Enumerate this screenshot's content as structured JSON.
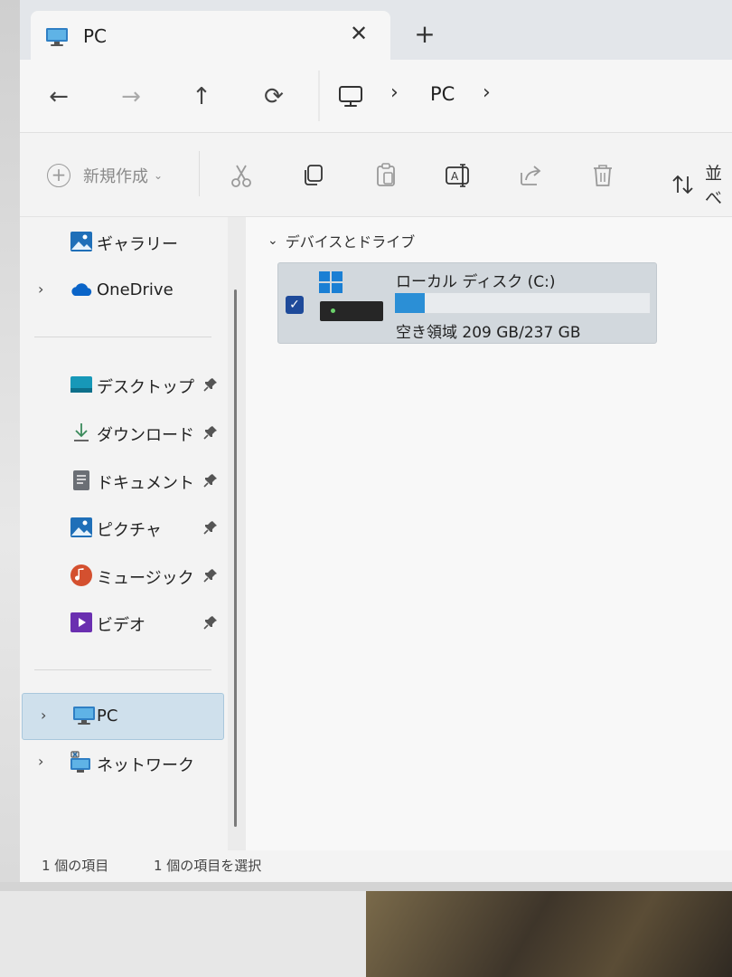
{
  "window": {
    "tab_title": "PC",
    "tab_close": "✕",
    "new_tab": "+"
  },
  "navigation": {
    "back": "←",
    "forward": "→",
    "up": "↑",
    "refresh": "⟳",
    "breadcrumb": [
      "PC"
    ],
    "chevron": "›"
  },
  "toolbar": {
    "new_label": "新規作成",
    "sort_label": "並べ"
  },
  "sidebar": {
    "top_items": [
      {
        "label": "ギャラリー",
        "icon": "gallery-icon"
      },
      {
        "label": "OneDrive",
        "icon": "onedrive-icon"
      }
    ],
    "quick_access": [
      {
        "label": "デスクトップ",
        "icon": "desktop-icon"
      },
      {
        "label": "ダウンロード",
        "icon": "download-icon"
      },
      {
        "label": "ドキュメント",
        "icon": "documents-icon"
      },
      {
        "label": "ピクチャ",
        "icon": "pictures-icon"
      },
      {
        "label": "ミュージック",
        "icon": "music-icon"
      },
      {
        "label": "ビデオ",
        "icon": "videos-icon"
      }
    ],
    "bottom_items": [
      {
        "label": "PC",
        "icon": "pc-icon",
        "selected": true
      },
      {
        "label": "ネットワーク",
        "icon": "network-icon"
      }
    ]
  },
  "main": {
    "group_header": "デバイスとドライブ",
    "drive": {
      "name": "ローカル ディスク (C:)",
      "space_text": "空き領域 209 GB/237 GB",
      "used_fraction": 0.118,
      "checked": true
    }
  },
  "status": {
    "item_count": "1 個の項目",
    "selected_count": "1 個の項目を選択"
  },
  "colors": {
    "accent": "#2b8fd6",
    "selected_bg": "#cfe0ec",
    "checkbox": "#1e4a9a"
  }
}
